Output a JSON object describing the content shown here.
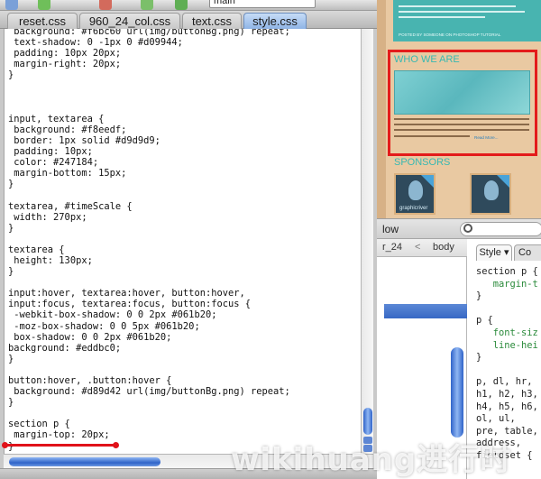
{
  "toolbar": {
    "search_value": "main",
    "icons": [
      "save-icon",
      "refresh-icon",
      "close-icon",
      "export-icon",
      "download-icon"
    ]
  },
  "tabs": [
    {
      "label": "reset.css",
      "active": false
    },
    {
      "label": "960_24_col.css",
      "active": false
    },
    {
      "label": "text.css",
      "active": false
    },
    {
      "label": "style.css",
      "active": true
    }
  ],
  "code_lines": [
    " background: #f6bc60 url(img/buttonBg.png) repeat;",
    " text-shadow: 0 -1px 0 #d09944;",
    " padding: 10px 20px;",
    " margin-right: 20px;",
    "}",
    "",
    "",
    "",
    "input, textarea {",
    " background: #f8eedf;",
    " border: 1px solid #d9d9d9;",
    " padding: 10px;",
    " color: #247184;",
    " margin-bottom: 15px;",
    "}",
    "",
    "textarea, #timeScale {",
    " width: 270px;",
    "}",
    "",
    "textarea {",
    " height: 130px;",
    "}",
    "",
    "input:hover, textarea:hover, button:hover,",
    "input:focus, textarea:focus, button:focus {",
    " -webkit-box-shadow: 0 0 2px #061b20;",
    " -moz-box-shadow: 0 0 5px #061b20;",
    " box-shadow: 0 0 2px #061b20;",
    "background: #eddbc0;",
    "}",
    "",
    "button:hover, .button:hover {",
    " background: #d89d42 url(img/buttonBg.png) repeat;",
    "}",
    "",
    "section p {",
    " margin-top: 20px;",
    "}"
  ],
  "preview": {
    "posted_text": "POSTED BY SOMEONE ON PHOTOSHOP TUTORIAL",
    "who_title": "WHO WE ARE",
    "read_more": "Read More...",
    "sponsors_title": "SPONSORS",
    "sponsor_brand": "graphicriver"
  },
  "inspector": {
    "title": "low",
    "crumbs": [
      "r_24",
      "<",
      "body"
    ],
    "tab_style": "Style ▾",
    "tab_computed": "Co",
    "style_lines": [
      {
        "text": "section p {",
        "prop": false
      },
      {
        "text": "   margin-t",
        "prop": true
      },
      {
        "text": "}",
        "prop": false
      },
      {
        "text": "",
        "prop": false
      },
      {
        "text": "p {",
        "prop": false
      },
      {
        "text": "   font-siz",
        "prop": true
      },
      {
        "text": "   line-hei",
        "prop": true
      },
      {
        "text": "}",
        "prop": false
      },
      {
        "text": "",
        "prop": false
      },
      {
        "text": "p, dl, hr,",
        "prop": false
      },
      {
        "text": "h1, h2, h3,",
        "prop": false
      },
      {
        "text": "h4, h5, h6,",
        "prop": false
      },
      {
        "text": "ol, ul,",
        "prop": false
      },
      {
        "text": "pre, table,",
        "prop": false
      },
      {
        "text": "address,",
        "prop": false
      },
      {
        "text": "fieldset {",
        "prop": false
      }
    ]
  },
  "watermark": "wikihuang进行时"
}
